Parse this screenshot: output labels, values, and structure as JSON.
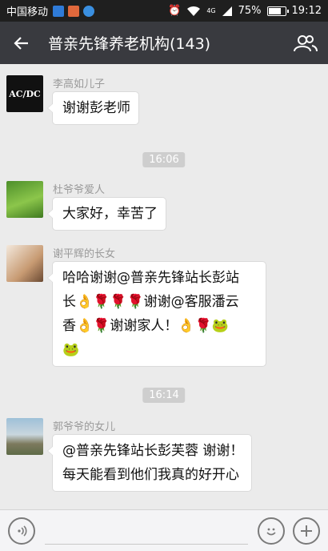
{
  "status_bar": {
    "carrier": "中国移动",
    "network": "4G",
    "battery": "75%",
    "battery_level": 0.75,
    "time": "19:12"
  },
  "header": {
    "title": "普亲先锋养老机构(143)"
  },
  "messages": [
    {
      "sender": "李高如儿子",
      "avatar_text": "AC/DC",
      "text": "谢谢彭老师"
    },
    {
      "sender": "杜爷爷爱人",
      "text": "大家好，幸苦了"
    },
    {
      "sender": "谢平辉的长女",
      "lines": [
        "哈哈谢谢@普亲先锋站长彭站",
        "长👌🌹🌹🌹谢谢@客服潘云",
        "香👌🌹谢谢家人！👌🌹🐸",
        "🐸"
      ]
    },
    {
      "sender": "郭爷爷的女儿",
      "lines": [
        "@普亲先锋站长彭芙蓉 谢谢！",
        "每天能看到他们我真的好开心"
      ]
    }
  ],
  "timestamps": [
    "16:06",
    "16:14"
  ],
  "colors": {
    "header_bg": "#393a3f",
    "chat_bg": "#ebebeb",
    "bubble_bg": "#ffffff",
    "time_pill": "#cecece"
  },
  "icons": [
    "back-arrow-icon",
    "group-members-icon",
    "voice-icon",
    "emoji-icon",
    "add-icon"
  ]
}
